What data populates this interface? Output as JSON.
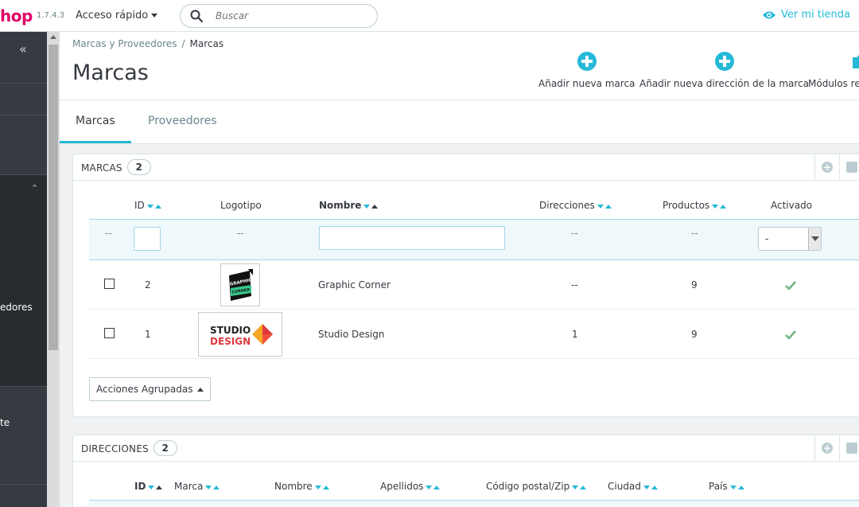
{
  "header": {
    "logo_text": "hop",
    "version": "1.7.4.3",
    "quick_access": "Acceso rápido",
    "search_placeholder": "Buscar",
    "view_store": "Ver mi tienda"
  },
  "sidebar": {
    "collapse_glyph": "«",
    "partial_items": [
      "edores",
      "te"
    ]
  },
  "breadcrumb": {
    "parent": "Marcas y Proveedores",
    "separator": "/",
    "current": "Marcas"
  },
  "page": {
    "title": "Marcas"
  },
  "toolbar": {
    "add_brand": "Añadir nueva marca",
    "add_brand_address": "Añadir nueva dirección de la marca",
    "modules_partial": "Módulos re"
  },
  "tabs": [
    {
      "label": "Marcas",
      "active": true
    },
    {
      "label": "Proveedores",
      "active": false
    }
  ],
  "brands_panel": {
    "title": "MARCAS",
    "count": "2",
    "columns": {
      "id": "ID",
      "logo": "Logotipo",
      "name": "Nombre",
      "addresses": "Direcciones",
      "products": "Productos",
      "active": "Activado"
    },
    "filters": {
      "select_all": "--",
      "logo": "--",
      "addresses": "--",
      "products": "--",
      "active_value": "-"
    },
    "rows": [
      {
        "id": "2",
        "name": "Graphic Corner",
        "addresses": "--",
        "products": "9",
        "active": true,
        "logo": "graphic-corner"
      },
      {
        "id": "1",
        "name": "Studio Design",
        "addresses": "1",
        "products": "9",
        "active": true,
        "logo": "studio-design"
      }
    ],
    "bulk_actions": "Acciones Agrupadas"
  },
  "logos": {
    "graphic_corner_lines": [
      "GRAPHIC",
      "CORNER"
    ],
    "studio_design_lines": [
      "STUDIO",
      "DESIGN"
    ]
  },
  "addresses_panel": {
    "title": "DIRECCIONES",
    "count": "2",
    "columns": {
      "id": "ID",
      "brand": "Marca",
      "first_name": "Nombre",
      "last_name": "Apellidos",
      "zip": "Código postal/Zip",
      "city": "Ciudad",
      "country": "País"
    }
  },
  "colors": {
    "accent": "#25b9d7",
    "brand_pink": "#df0067",
    "success": "#70b580",
    "sidebar": "#363a41"
  }
}
